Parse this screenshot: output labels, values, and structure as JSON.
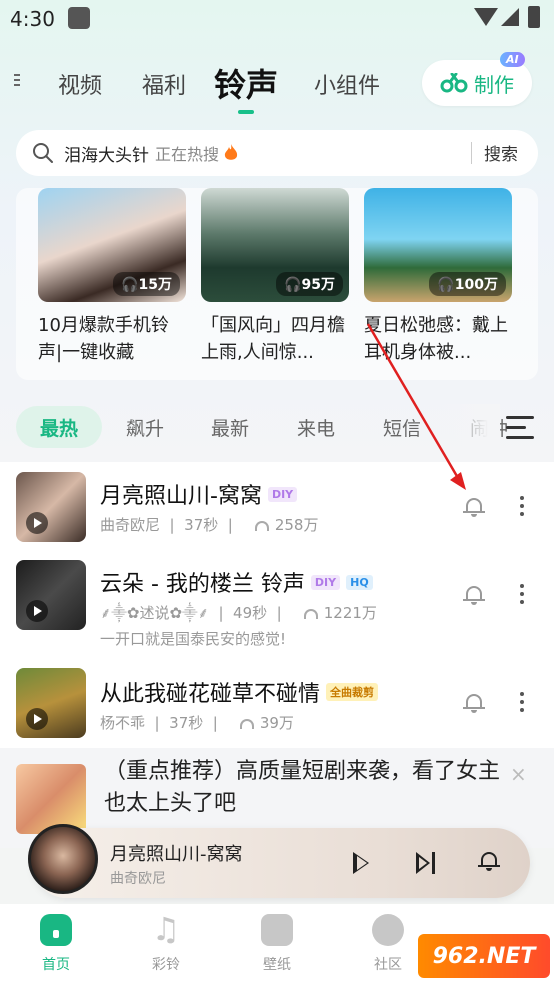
{
  "status_bar": {
    "time": "4:30"
  },
  "top_nav": {
    "tabs": [
      "视频",
      "福利",
      "铃声",
      "小组件"
    ],
    "active_tab": "铃声",
    "make_button": "制作",
    "ai_badge": "AI"
  },
  "search": {
    "query": "泪海大头针",
    "hot_label": "正在热搜",
    "button": "搜索"
  },
  "playlists": [
    {
      "title": "10月爆款手机铃声|一键收藏",
      "plays": "15万"
    },
    {
      "title": "「国风向」四月檐上雨,人间惊...",
      "plays": "95万"
    },
    {
      "title": "夏日松弛感：戴上耳机身体被...",
      "plays": "100万"
    }
  ],
  "category_tabs": [
    "最热",
    "飙升",
    "最新",
    "来电",
    "短信",
    "闹钟"
  ],
  "active_category": "最热",
  "songs": [
    {
      "title": "月亮照山川-窝窝",
      "tags": [
        "DIY"
      ],
      "artist": "曲奇欧尼",
      "duration": "37秒",
      "plays": "258万",
      "desc": ""
    },
    {
      "title": "云朵 - 我的楼兰 铃声",
      "tags": [
        "DIY",
        "HQ"
      ],
      "artist": "⸙⸎✿述说✿⸎⸙",
      "duration": "49秒",
      "plays": "1221万",
      "desc": "一开口就是国泰民安的感觉!"
    },
    {
      "title": "从此我碰花碰草不碰情",
      "tags": [
        "全曲裁剪"
      ],
      "artist": "杨不乖",
      "duration": "37秒",
      "plays": "39万",
      "desc": ""
    }
  ],
  "ad": {
    "text": "（重点推荐）高质量短剧来袭，看了女主也太上头了吧",
    "close": "×"
  },
  "player": {
    "title": "月亮照山川-窝窝",
    "artist": "曲奇欧尼"
  },
  "bottom_nav": [
    {
      "label": "首页",
      "icon": "home-icon",
      "active": true
    },
    {
      "label": "彩铃",
      "icon": "music-note-icon",
      "active": false
    },
    {
      "label": "壁纸",
      "icon": "wallpaper-icon",
      "active": false
    },
    {
      "label": "社区",
      "icon": "planet-icon",
      "active": false
    }
  ],
  "watermark": "962.NET",
  "colors": {
    "accent": "#19b783",
    "annotation_arrow": "#e02020"
  }
}
